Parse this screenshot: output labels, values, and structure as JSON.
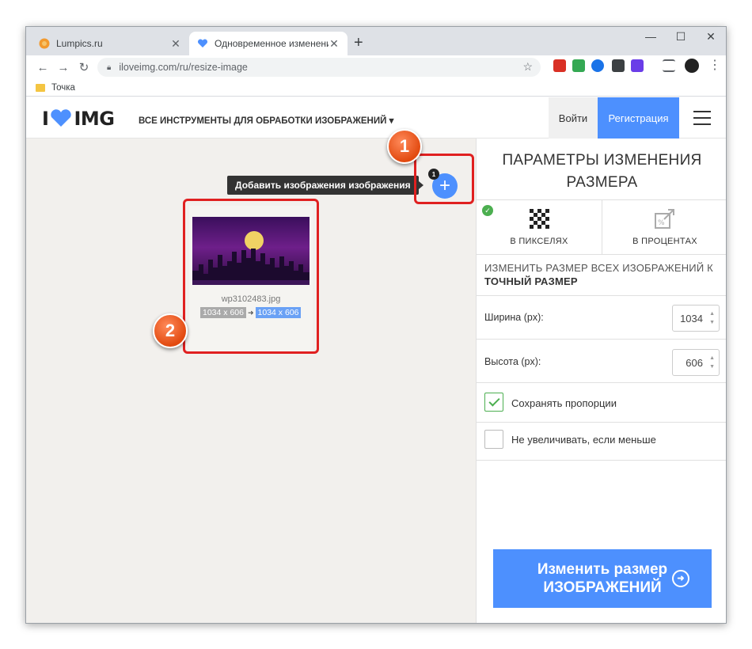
{
  "browser": {
    "tabs": [
      {
        "title": "Lumpics.ru",
        "favicon": "lumpics-favicon"
      },
      {
        "title": "Одновременное изменение раз",
        "favicon": "iloveimg-favicon"
      }
    ],
    "address": "iloveimg.com/ru/resize-image",
    "bookmark": "Точка",
    "window_controls": {
      "minimize": "—",
      "maximize": "☐",
      "close": "✕"
    }
  },
  "site": {
    "logo_left": "I",
    "logo_right": "IMG",
    "all_tools": "ВСЕ ИНСТРУМЕНТЫ ДЛЯ ОБРАБОТКИ ИЗОБРАЖЕНИЙ",
    "login": "Войти",
    "register": "Регистрация",
    "brand_color": "#4d90fe",
    "accent_red": "#e5322d"
  },
  "workspace": {
    "tooltip": "Добавить изображения изображения",
    "add_badge": "1",
    "file": {
      "name": "wp3102483.jpg",
      "original": "1034 x 606",
      "resized": "1034 x 606"
    },
    "markers": [
      "1",
      "2"
    ]
  },
  "sidebar": {
    "title": "ПАРАМЕТРЫ ИЗМЕНЕНИЯ РАЗМЕРА",
    "tabs": [
      {
        "label": "В ПИКСЕЛЯХ",
        "icon": "pixels-icon",
        "selected": true
      },
      {
        "label": "В ПРОЦЕНТАХ",
        "icon": "percent-resize-icon",
        "selected": false
      }
    ],
    "desc_line1": "ИЗМЕНИТЬ РАЗМЕР ВСЕХ ИЗОБРАЖЕНИЙ К",
    "desc_line2": "ТОЧНЫЙ РАЗМЕР",
    "width_label": "Ширина (px):",
    "width_value": "1034",
    "height_label": "Высота (px):",
    "height_value": "606",
    "keep_ratio": "Сохранять пропорции",
    "keep_ratio_checked": true,
    "no_enlarge": "Не увеличивать, если меньше",
    "no_enlarge_checked": false,
    "submit": "Изменить размер ИЗОБРАЖЕНИЙ"
  }
}
